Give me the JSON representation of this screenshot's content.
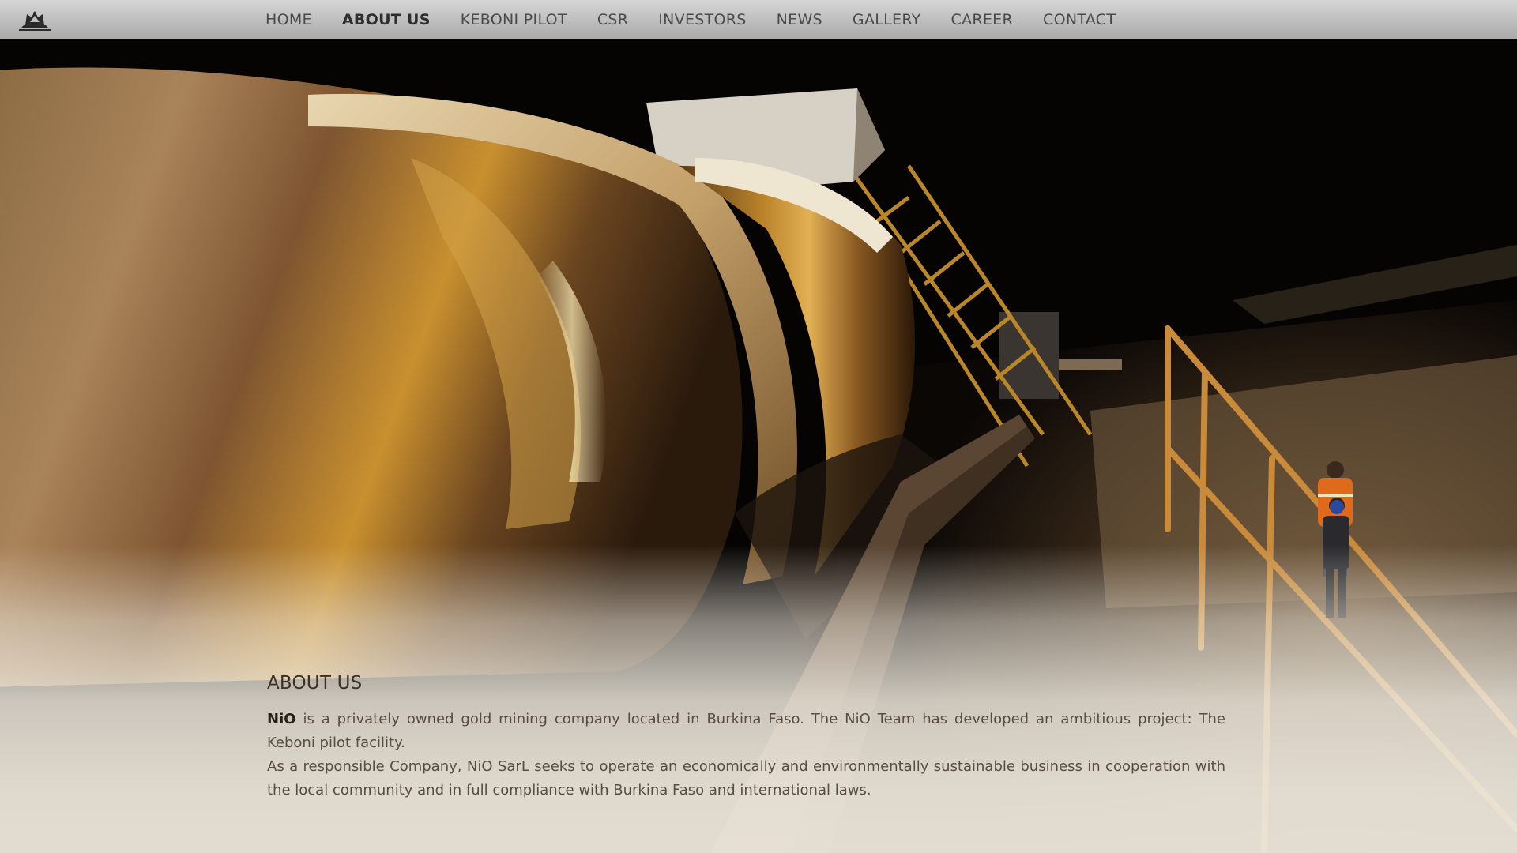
{
  "nav": {
    "logo_icon": "crest-logo-icon",
    "items": [
      {
        "label": "HOME",
        "active": false
      },
      {
        "label": "ABOUT US",
        "active": true
      },
      {
        "label": "KEBONI PILOT",
        "active": false
      },
      {
        "label": "CSR",
        "active": false
      },
      {
        "label": "INVESTORS",
        "active": false
      },
      {
        "label": "NEWS",
        "active": false
      },
      {
        "label": "GALLERY",
        "active": false
      },
      {
        "label": "CAREER",
        "active": false
      },
      {
        "label": "CONTACT",
        "active": false
      }
    ]
  },
  "about": {
    "title": "ABOUT US",
    "brand": "NiO",
    "paragraph1_rest": " is a privately owned gold mining company located in Burkina Faso. The NiO Team has developed an ambitious project: The Keboni pilot facility.",
    "paragraph2": "As a responsible Company, NiO SarL seeks to operate an economically and environmentally sustainable business in cooperation with the local community and in full compliance with Burkina Faso and international laws."
  },
  "colors": {
    "nav_bg": "#bdbdbd",
    "nav_text": "#4a4a4a",
    "accent_gold": "#b07d2a",
    "night_sky": "#050403",
    "fade_cream": "#ece6da",
    "worker_orange": "#e06a1c"
  }
}
